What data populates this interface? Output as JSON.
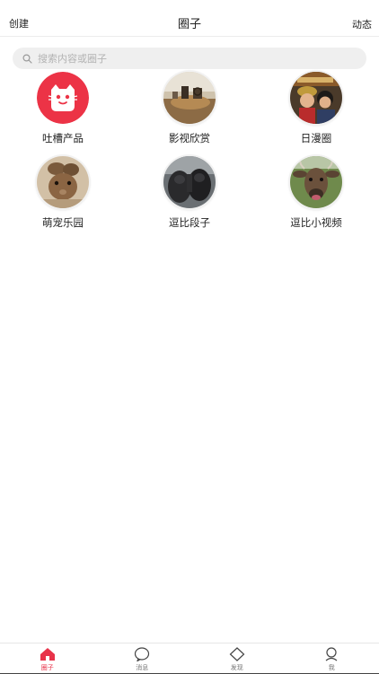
{
  "header": {
    "left_label": "创建",
    "title": "圈子",
    "right_label": "动态"
  },
  "search": {
    "placeholder": "搜索内容或圈子",
    "value": "",
    "icon": "search-icon"
  },
  "circles": [
    {
      "label": "吐槽产品",
      "icon": "cat-face-logo"
    },
    {
      "label": "影视欣赏",
      "icon": "film-photo"
    },
    {
      "label": "日漫圈",
      "icon": "one-piece-photo"
    },
    {
      "label": "萌宠乐园",
      "icon": "rabbit-photo"
    },
    {
      "label": "逗比段子",
      "icon": "gorilla-photo"
    },
    {
      "label": "逗比小视频",
      "icon": "cow-photo"
    }
  ],
  "tabbar": {
    "items": [
      {
        "label": "圈子",
        "icon": "home-icon",
        "active": true
      },
      {
        "label": "消息",
        "icon": "chat-bubble-icon",
        "active": false
      },
      {
        "label": "发现",
        "icon": "diamond-icon",
        "active": false
      },
      {
        "label": "我",
        "icon": "person-icon",
        "active": false
      }
    ]
  },
  "colors": {
    "accent": "#e8334a",
    "search_bg": "#efefef",
    "text": "#222222"
  }
}
